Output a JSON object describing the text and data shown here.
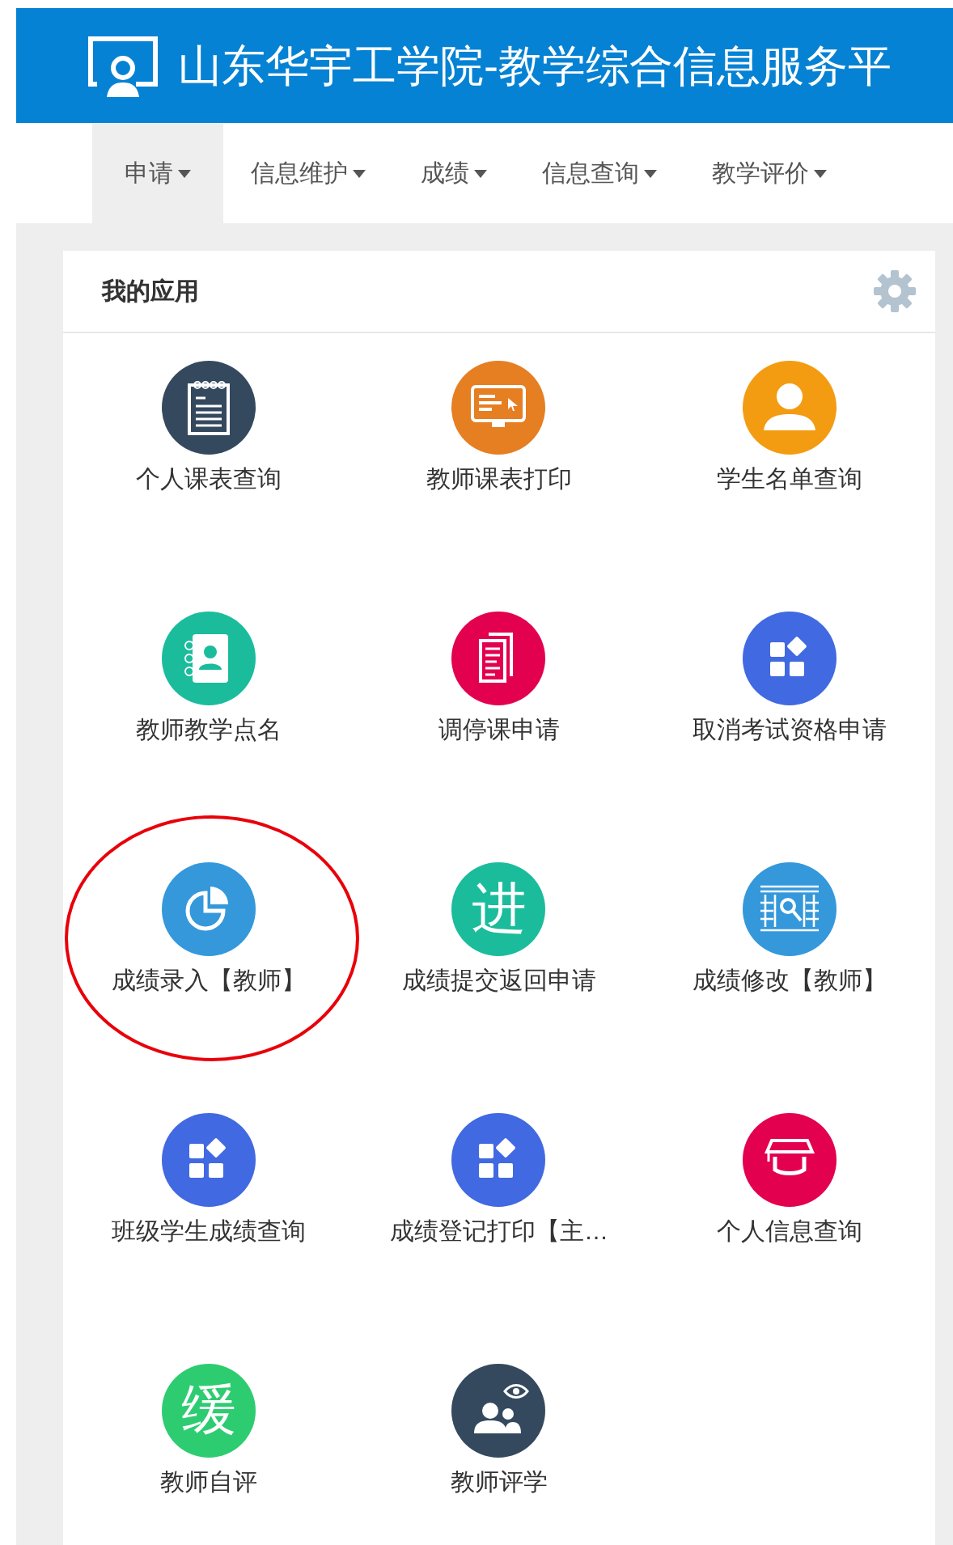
{
  "header": {
    "title": "山东华宇工学院-教学综合信息服务平"
  },
  "nav": [
    {
      "label": "申请",
      "selected": true
    },
    {
      "label": "信息维护",
      "selected": false
    },
    {
      "label": "成绩",
      "selected": false
    },
    {
      "label": "信息查询",
      "selected": false
    },
    {
      "label": "教学评价",
      "selected": false
    }
  ],
  "panel": {
    "title": "我的应用"
  },
  "apps": [
    {
      "label": "个人课表查询",
      "kind": "notebook",
      "color": "#34495e",
      "circled": false
    },
    {
      "label": "教师课表打印",
      "kind": "monitor",
      "color": "#e67e22",
      "circled": false
    },
    {
      "label": "学生名单查询",
      "kind": "person",
      "color": "#f39c12",
      "circled": false
    },
    {
      "label": "教师教学点名",
      "kind": "contacts",
      "color": "#1abc9c",
      "circled": false
    },
    {
      "label": "调停课申请",
      "kind": "documents",
      "color": "#e3004f",
      "circled": false
    },
    {
      "label": "取消考试资格申请",
      "kind": "tiles",
      "color": "#4169e1",
      "circled": false
    },
    {
      "label": "成绩录入【教师】",
      "kind": "pie",
      "color": "#3498db",
      "circled": true
    },
    {
      "label": "成绩提交返回申请",
      "kind": "glyph",
      "glyph": "进",
      "color": "#1abc9c",
      "circled": false
    },
    {
      "label": "成绩修改【教师】",
      "kind": "table",
      "color": "#3498db",
      "circled": false
    },
    {
      "label": "班级学生成绩查询",
      "kind": "tiles",
      "color": "#4169e1",
      "circled": false
    },
    {
      "label": "成绩登记打印【主…",
      "kind": "tiles",
      "color": "#4169e1",
      "circled": false
    },
    {
      "label": "个人信息查询",
      "kind": "cap",
      "color": "#e3004f",
      "circled": false
    },
    {
      "label": "教师自评",
      "kind": "glyph",
      "glyph": "缓",
      "color": "#2ecc71",
      "circled": false
    },
    {
      "label": "教师评学",
      "kind": "eye-people",
      "color": "#34495e",
      "circled": false
    }
  ]
}
